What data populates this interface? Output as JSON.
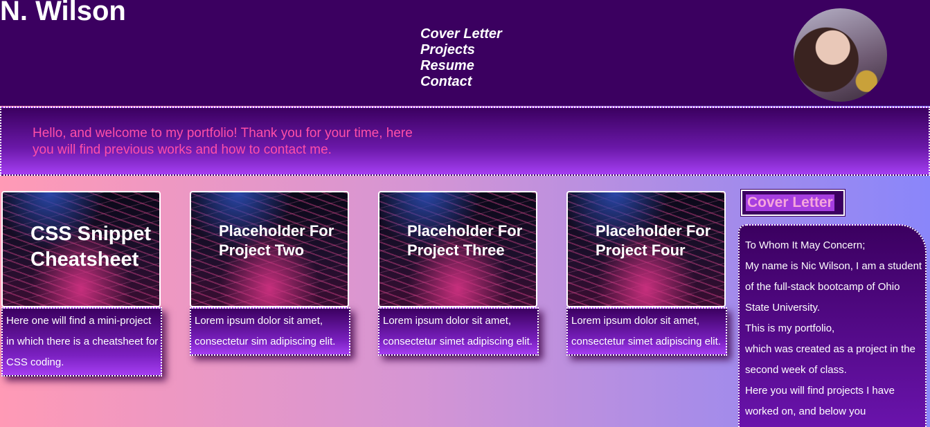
{
  "header": {
    "site_name": "N. Wilson",
    "nav": [
      "Cover Letter",
      "Projects",
      "Resume",
      "Contact"
    ],
    "avatar": "profile-photo"
  },
  "welcome": {
    "text": "Hello, and welcome to my portfolio! Thank you for your time, here you will find previous works and how to contact me."
  },
  "projects": [
    {
      "title": "CSS Snippet Cheatsheet",
      "description": "Here one will find a mini-project in which there is a cheatsheet for CSS coding."
    },
    {
      "title": "Placeholder For Project Two",
      "description": "Lorem ipsum dolor sit amet, consectetur sim adipiscing elit."
    },
    {
      "title": "Placeholder For Project Three",
      "description": "Lorem ipsum dolor sit amet, consectetur simet adipiscing elit."
    },
    {
      "title": "Placeholder For Project Four",
      "description": "Lorem ipsum dolor sit amet, consectetur simet adipiscing elit."
    }
  ],
  "cover_letter": {
    "heading": "Cover Letter",
    "lines": [
      "To Whom It May Concern;",
      "My name is Nic Wilson, I am a student of the full-stack bootcamp of Ohio State University.",
      "This is my portfolio,",
      "which was created as a project in the second week of class.",
      "Here you will find projects I have worked on, and below you"
    ]
  },
  "colors": {
    "header_bg": "#3b0060",
    "accent_pink": "#ff4fa8",
    "heading_pink": "#f6a6dc"
  }
}
